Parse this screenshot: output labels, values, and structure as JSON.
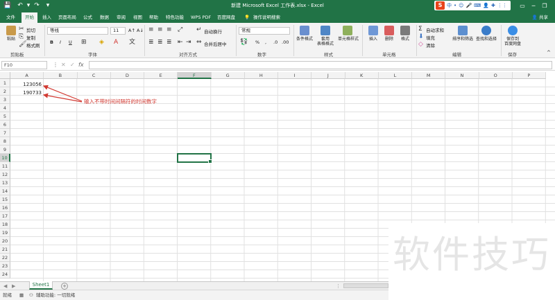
{
  "window": {
    "title": "新建 Microsoft Excel 工作表.xlsx - Excel",
    "ime_logo": "S",
    "ime_items": [
      "中",
      "•",
      "☺",
      "🎤",
      "⌨",
      "👤",
      "✚",
      "⋮⋮"
    ]
  },
  "tabs": [
    {
      "label": "文件",
      "active": false
    },
    {
      "label": "开始",
      "active": true
    },
    {
      "label": "插入",
      "active": false
    },
    {
      "label": "页面布局",
      "active": false
    },
    {
      "label": "公式",
      "active": false
    },
    {
      "label": "数据",
      "active": false
    },
    {
      "label": "审阅",
      "active": false
    },
    {
      "label": "视图",
      "active": false
    },
    {
      "label": "帮助",
      "active": false
    },
    {
      "label": "特色功能",
      "active": false
    },
    {
      "label": "WPS PDF",
      "active": false
    },
    {
      "label": "百度网盘",
      "active": false
    }
  ],
  "tell_me": "操作说明搜索",
  "share": "共享",
  "ribbon": {
    "clipboard": {
      "paste": "粘贴",
      "cut": "剪切",
      "copy": "复制",
      "format_painter": "格式刷",
      "group": "剪贴板"
    },
    "font": {
      "name": "等线",
      "size": "11",
      "bold": "B",
      "italic": "I",
      "underline": "U",
      "grow": "A↑",
      "shrink": "A↓",
      "group": "字体"
    },
    "alignment": {
      "wrap": "自动换行",
      "merge": "合并后居中",
      "group": "对齐方式"
    },
    "number": {
      "format": "常规",
      "percent": "%",
      "comma": ",",
      "group": "数字"
    },
    "styles": {
      "conditional": "条件格式",
      "table": "套用\n表格格式",
      "cell_styles": "单元格样式",
      "group": "样式"
    },
    "cells": {
      "insert": "插入",
      "delete": "删除",
      "format": "格式",
      "group": "单元格"
    },
    "editing": {
      "autosum": "自动求和",
      "fill": "填充",
      "clear": "清除",
      "sort": "排序和筛选",
      "find": "查找和选择",
      "group": "编辑"
    },
    "save": {
      "save_to": "保存到\n百度网盘",
      "group": "保存"
    }
  },
  "formula_bar": {
    "name_box": "F10",
    "value": ""
  },
  "columns": [
    "A",
    "B",
    "C",
    "D",
    "E",
    "F",
    "G",
    "H",
    "I",
    "J",
    "K",
    "L",
    "M",
    "N",
    "O",
    "P"
  ],
  "rows": [
    "1",
    "2",
    "3",
    "4",
    "5",
    "6",
    "7",
    "8",
    "9",
    "10",
    "11",
    "12",
    "13",
    "14",
    "15",
    "16",
    "17",
    "18",
    "19",
    "20",
    "21",
    "22",
    "23",
    "24"
  ],
  "selected": {
    "column": "F",
    "row": "10"
  },
  "cells": [
    {
      "ref": "A1",
      "value": "123056"
    },
    {
      "ref": "A2",
      "value": "190733"
    }
  ],
  "annotation": "输入不带时间间隔符的时间数字",
  "sheets": [
    {
      "name": "Sheet1",
      "active": true
    }
  ],
  "status": {
    "ready": "就绪",
    "accessibility": "辅助功能: 一切就绪"
  },
  "watermark": "软件技巧",
  "colors": {
    "excel_green": "#217346",
    "annotation_red": "#d23a32"
  }
}
